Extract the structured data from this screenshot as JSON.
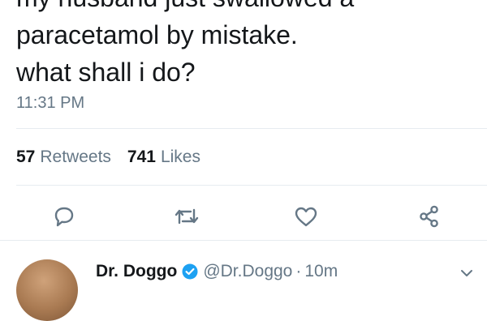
{
  "tweet": {
    "text_lines": [
      "my husband just swallowed a",
      "paracetamol by mistake.",
      "what shall i do?"
    ],
    "time": "11:31 PM"
  },
  "stats": {
    "retweets_count": "57",
    "retweets_label": "Retweets",
    "likes_count": "741",
    "likes_label": "Likes"
  },
  "actions": {
    "reply_icon": "reply-icon",
    "retweet_icon": "retweet-icon",
    "like_icon": "heart-icon",
    "share_icon": "share-icon"
  },
  "reply": {
    "author_name": "Dr. Doggo",
    "handle": "@Dr.Doggo",
    "separator": "·",
    "age": "10m"
  },
  "colors": {
    "icon": "#657786",
    "verified": "#1da1f2",
    "divider": "#e6ecf0"
  }
}
